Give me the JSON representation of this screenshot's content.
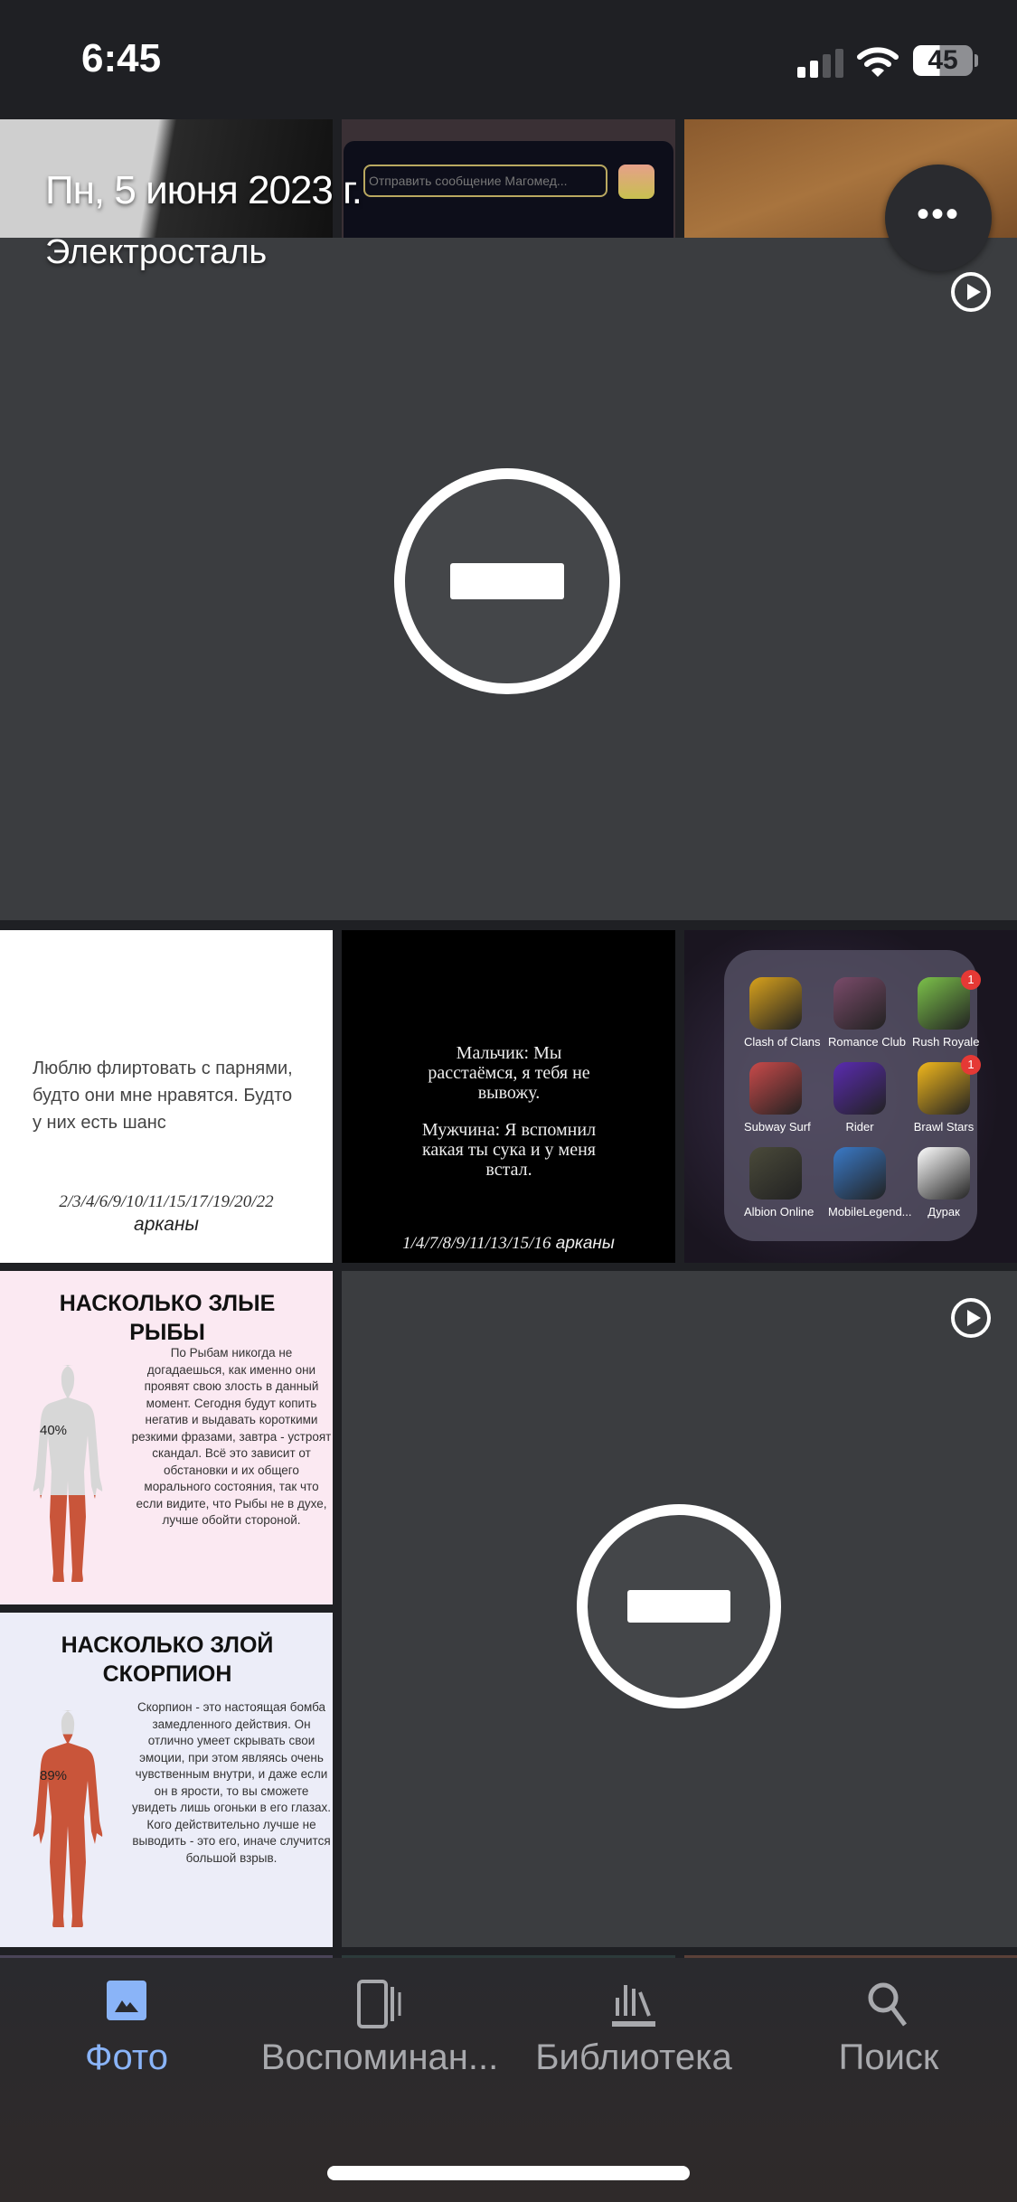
{
  "status": {
    "time": "6:45",
    "battery": "45",
    "signal_bars": 2
  },
  "header": {
    "date": "Пн, 5 июня 2023 г.",
    "location": "Электросталь",
    "more_icon": "more-horizontal-icon"
  },
  "thumbs_top": {
    "message_placeholder": "Отправить сообщение Магомед..."
  },
  "row2": {
    "quote": "Люблю флиртовать с парнями, будто они мне нравятся. Будто у них есть шанс",
    "quote_arcana": "2/3/4/6/9/10/11/15/17/19/20/22",
    "arcana_word": "арканы",
    "joke1": "Мальчик: Мы расстаёмся, я тебя не вывожу.",
    "joke2": "Мужчина: Я вспомнил какая ты сука и у меня встал.",
    "joke_arcana": "1/4/7/8/9/11/13/15/16",
    "apps": [
      {
        "name": "Clash of Clans",
        "color": "#d9a21c",
        "badge": ""
      },
      {
        "name": "Romance Club",
        "color": "#7a4b6a",
        "badge": ""
      },
      {
        "name": "Rush Royale",
        "color": "#7cc24a",
        "badge": "1"
      },
      {
        "name": "Subway Surf",
        "color": "#c94a4a",
        "badge": ""
      },
      {
        "name": "Rider",
        "color": "#5a2bb0",
        "badge": ""
      },
      {
        "name": "Brawl Stars",
        "color": "#f2b81c",
        "badge": "1"
      },
      {
        "name": "Albion Online",
        "color": "#4a4a3a",
        "badge": ""
      },
      {
        "name": "MobileLegend...",
        "color": "#3a7ac8",
        "badge": ""
      },
      {
        "name": "Дурак",
        "color": "#ffffff",
        "badge": ""
      }
    ]
  },
  "pisces": {
    "title": "НАСКОЛЬКО ЗЛЫЕ РЫБЫ",
    "percent": "40%",
    "fill": 0.4,
    "text": "По Рыбам никогда не догадаешься, как именно они проявят свою злость в данный момент. Сегодня будут копить негатив и выдавать короткими резкими фразами, завтра - устроят скандал. Всё это зависит от обстановки и их общего морального состояния, так что если видите, что Рыбы не в духе, лучше обойти стороной."
  },
  "scorpio": {
    "title": "НАСКОЛЬКО ЗЛОЙ СКОРПИОН",
    "percent": "89%",
    "fill": 0.89,
    "text": "Скорпион - это настоящая бомба замедленного действия. Он отлично умеет скрывать свои эмоции, при этом являясь очень чувственным внутри, и даже если он в ярости, то вы сможете увидеть лишь огоньки в его глазах. Кого действительно лучше не выводить - это его, иначе случится большой взрыв."
  },
  "nav": [
    {
      "label": "Фото",
      "icon": "photo-icon",
      "active": true
    },
    {
      "label": "Воспоминан...",
      "icon": "memories-icon",
      "active": false
    },
    {
      "label": "Библиотека",
      "icon": "library-icon",
      "active": false
    },
    {
      "label": "Поиск",
      "icon": "search-icon",
      "active": false
    }
  ],
  "colors": {
    "accent": "#8ab4f8",
    "tile_bg": "#3b3d40",
    "figure": "#c9553a"
  }
}
